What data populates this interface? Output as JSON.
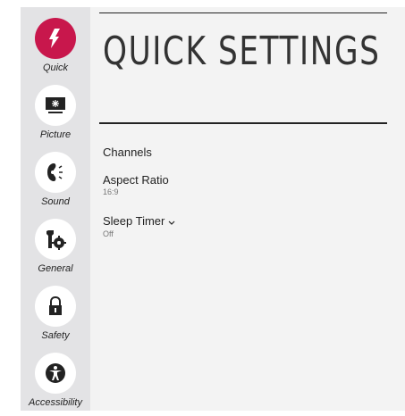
{
  "sidebar": {
    "items": [
      {
        "label": "Quick",
        "icon": "lightning-icon",
        "active": true
      },
      {
        "label": "Picture",
        "icon": "picture-monitor-icon"
      },
      {
        "label": "Sound",
        "icon": "speaker-icon"
      },
      {
        "label": "General",
        "icon": "wrench-gear-icon"
      },
      {
        "label": "Safety",
        "icon": "lock-icon"
      },
      {
        "label": "Accessibility",
        "icon": "accessibility-icon"
      }
    ]
  },
  "main": {
    "title": "QUICK SETTINGS",
    "items": [
      {
        "label": "Channels",
        "value": ""
      },
      {
        "label": "Aspect Ratio",
        "value": "16:9"
      },
      {
        "label": "Sleep Timer",
        "value": "Off"
      }
    ]
  },
  "colors": {
    "accent": "#c8174c",
    "sidebar_bg": "#e3e3e5",
    "content_bg": "#f3f3f3"
  }
}
